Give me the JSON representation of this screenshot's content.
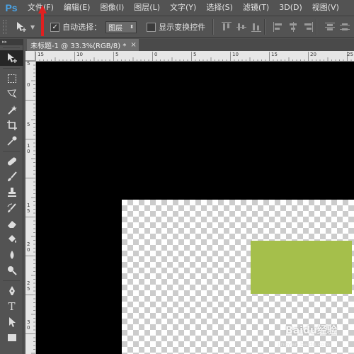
{
  "app": {
    "logo": "Ps"
  },
  "menu": [
    {
      "label": "文件(F)"
    },
    {
      "label": "编辑(E)"
    },
    {
      "label": "图像(I)"
    },
    {
      "label": "图层(L)"
    },
    {
      "label": "文字(Y)"
    },
    {
      "label": "选择(S)"
    },
    {
      "label": "滤镜(T)"
    },
    {
      "label": "3D(D)"
    },
    {
      "label": "视图(V)"
    }
  ],
  "options": {
    "auto_select_label": "自动选择：",
    "auto_select_checked": true,
    "auto_select_value": "图层",
    "show_transform_label": "显示变换控件",
    "show_transform_checked": false
  },
  "document": {
    "tab_title": "未标题-1 @ 33.3%(RGB/8) *",
    "close_glyph": "×",
    "layer_color": "#a5bf4b"
  },
  "rulers": {
    "horizontal": [
      "15",
      "10",
      "5",
      "0",
      "5",
      "10",
      "15",
      "20",
      "25"
    ],
    "vertical": [
      "5",
      "0",
      "5",
      "1 0",
      "1 5",
      "2 0",
      "2 5",
      "3 0"
    ]
  },
  "icons": {
    "move": "move-icon",
    "marquee": "marquee-icon",
    "lasso": "lasso-icon",
    "magic_wand": "magic-wand-icon",
    "crop": "crop-icon",
    "eyedropper": "eyedropper-icon",
    "healing": "healing-brush-icon",
    "brush": "brush-icon",
    "stamp": "clone-stamp-icon",
    "history_brush": "history-brush-icon",
    "eraser": "eraser-icon",
    "paint_bucket": "paint-bucket-icon",
    "blur": "blur-icon",
    "dodge": "dodge-icon",
    "pen": "pen-icon",
    "type": "type-icon",
    "path_select": "path-selection-icon",
    "rectangle": "rectangle-icon"
  },
  "watermark": {
    "text": "Baidu经验",
    "sub": "jingyan.baidu.com"
  },
  "accent": {
    "arrow": "#e02020",
    "ps_blue": "#4aa4e8"
  }
}
